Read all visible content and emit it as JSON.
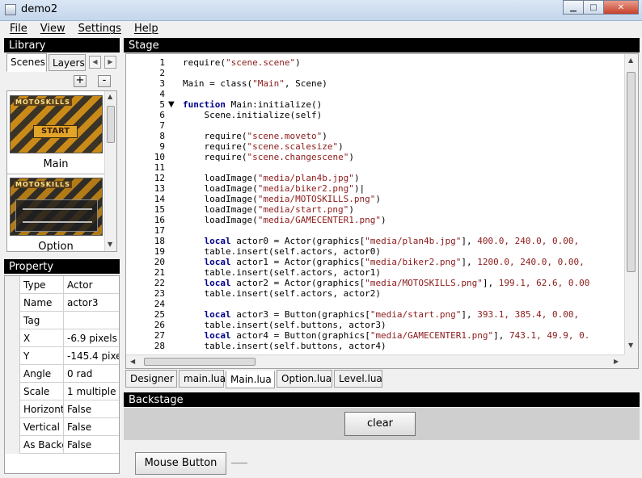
{
  "window": {
    "title": "demo2",
    "minimize": "▁",
    "maximize": "□",
    "close": "✕"
  },
  "menu": [
    "File",
    "View",
    "Settings",
    "Help"
  ],
  "library": {
    "header": "Library",
    "tabs": [
      "Scenes",
      "Layers"
    ],
    "add": "+",
    "remove": "-",
    "scenes": [
      {
        "name": "Main",
        "logo": "MOTOSKILLS",
        "button": "START"
      },
      {
        "name": "Option",
        "logo": "MOTOSKILLS"
      }
    ]
  },
  "property": {
    "header": "Property",
    "rows": [
      {
        "key": "Type",
        "value": "Actor"
      },
      {
        "key": "Name",
        "value": "actor3"
      },
      {
        "key": "Tag",
        "value": ""
      },
      {
        "key": "X",
        "value": "-6.9 pixels"
      },
      {
        "key": "Y",
        "value": "-145.4 pixe"
      },
      {
        "key": "Angle",
        "value": "0 rad"
      },
      {
        "key": "Scale",
        "value": "1 multiple"
      },
      {
        "key": "Horizont",
        "value": "False"
      },
      {
        "key": "Vertical",
        "value": "False"
      },
      {
        "key": "As Backg",
        "value": "False"
      }
    ]
  },
  "stage": {
    "header": "Stage",
    "folded_lines": [
      5
    ],
    "lines": [
      [
        {
          "t": "require(",
          "c": ""
        },
        {
          "t": "\"scene.scene\"",
          "c": "str"
        },
        {
          "t": ")",
          "c": ""
        }
      ],
      [],
      [
        {
          "t": "Main = class(",
          "c": ""
        },
        {
          "t": "\"Main\"",
          "c": "str"
        },
        {
          "t": ", Scene)",
          "c": ""
        }
      ],
      [],
      [
        {
          "t": "function",
          "c": "kw"
        },
        {
          "t": " Main:initialize()",
          "c": ""
        }
      ],
      [
        {
          "t": "    Scene.initialize(self)",
          "c": ""
        }
      ],
      [],
      [
        {
          "t": "    require(",
          "c": ""
        },
        {
          "t": "\"scene.moveto\"",
          "c": "str"
        },
        {
          "t": ")",
          "c": ""
        }
      ],
      [
        {
          "t": "    require(",
          "c": ""
        },
        {
          "t": "\"scene.scalesize\"",
          "c": "str"
        },
        {
          "t": ")",
          "c": ""
        }
      ],
      [
        {
          "t": "    require(",
          "c": ""
        },
        {
          "t": "\"scene.changescene\"",
          "c": "str"
        },
        {
          "t": ")",
          "c": ""
        }
      ],
      [],
      [
        {
          "t": "    loadImage(",
          "c": ""
        },
        {
          "t": "\"media/plan4b.jpg\"",
          "c": "str"
        },
        {
          "t": ")",
          "c": ""
        }
      ],
      [
        {
          "t": "    loadImage(",
          "c": ""
        },
        {
          "t": "\"media/biker2.png\"",
          "c": "str"
        },
        {
          "t": ")|",
          "c": ""
        }
      ],
      [
        {
          "t": "    loadImage(",
          "c": ""
        },
        {
          "t": "\"media/MOTOSKILLS.png\"",
          "c": "str"
        },
        {
          "t": ")",
          "c": ""
        }
      ],
      [
        {
          "t": "    loadImage(",
          "c": ""
        },
        {
          "t": "\"media/start.png\"",
          "c": "str"
        },
        {
          "t": ")",
          "c": ""
        }
      ],
      [
        {
          "t": "    loadImage(",
          "c": ""
        },
        {
          "t": "\"media/GAMECENTER1.png\"",
          "c": "str"
        },
        {
          "t": ")",
          "c": ""
        }
      ],
      [],
      [
        {
          "t": "    ",
          "c": ""
        },
        {
          "t": "local",
          "c": "kw"
        },
        {
          "t": " actor0 = Actor(graphics[",
          "c": ""
        },
        {
          "t": "\"media/plan4b.jpg\"",
          "c": "str"
        },
        {
          "t": "], ",
          "c": ""
        },
        {
          "t": "400.0, 240.0, 0.00,",
          "c": "str"
        }
      ],
      [
        {
          "t": "    table.insert(self.actors, actor0)",
          "c": ""
        }
      ],
      [
        {
          "t": "    ",
          "c": ""
        },
        {
          "t": "local",
          "c": "kw"
        },
        {
          "t": " actor1 = Actor(graphics[",
          "c": ""
        },
        {
          "t": "\"media/biker2.png\"",
          "c": "str"
        },
        {
          "t": "], ",
          "c": ""
        },
        {
          "t": "1200.0, 240.0, 0.00,",
          "c": "str"
        }
      ],
      [
        {
          "t": "    table.insert(self.actors, actor1)",
          "c": ""
        }
      ],
      [
        {
          "t": "    ",
          "c": ""
        },
        {
          "t": "local",
          "c": "kw"
        },
        {
          "t": " actor2 = Actor(graphics[",
          "c": ""
        },
        {
          "t": "\"media/MOTOSKILLS.png\"",
          "c": "str"
        },
        {
          "t": "], ",
          "c": ""
        },
        {
          "t": "199.1, 62.6, 0.00",
          "c": "str"
        }
      ],
      [
        {
          "t": "    table.insert(self.actors, actor2)",
          "c": ""
        }
      ],
      [],
      [
        {
          "t": "    ",
          "c": ""
        },
        {
          "t": "local",
          "c": "kw"
        },
        {
          "t": " actor3 = Button(graphics[",
          "c": ""
        },
        {
          "t": "\"media/start.png\"",
          "c": "str"
        },
        {
          "t": "], ",
          "c": ""
        },
        {
          "t": "393.1, 385.4, 0.00,",
          "c": "str"
        }
      ],
      [
        {
          "t": "    table.insert(self.buttons, actor3)",
          "c": ""
        }
      ],
      [
        {
          "t": "    ",
          "c": ""
        },
        {
          "t": "local",
          "c": "kw"
        },
        {
          "t": " actor4 = Button(graphics[",
          "c": ""
        },
        {
          "t": "\"media/GAMECENTER1.png\"",
          "c": "str"
        },
        {
          "t": "], ",
          "c": ""
        },
        {
          "t": "743.1, 49.9, 0.",
          "c": "str"
        }
      ],
      [
        {
          "t": "    table.insert(self.buttons, actor4)",
          "c": ""
        }
      ]
    ]
  },
  "doc_tabs": [
    "Designer",
    "main.lua",
    "Main.lua",
    "Option.lua",
    "Level.lua"
  ],
  "active_doc_tab": "Main.lua",
  "backstage": {
    "header": "Backstage",
    "clear_label": "clear",
    "mouse_button_label": "Mouse Button <<"
  }
}
